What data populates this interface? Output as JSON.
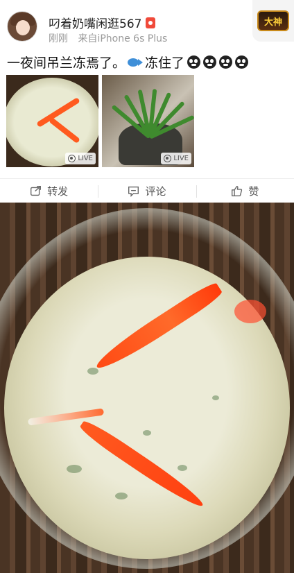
{
  "post": {
    "username": "叼着奶嘴闲逛567",
    "time": "刚刚",
    "source": "来自iPhone 6s Plus",
    "text": "一夜间吊兰冻焉了。",
    "text_after_fish": "冻住了",
    "game_badge": "大神"
  },
  "thumbnails": [
    {
      "name": "goldfish-bowl-photo",
      "live_label": "LIVE"
    },
    {
      "name": "spider-plant-photo",
      "live_label": "LIVE"
    }
  ],
  "actions": {
    "repost": "转发",
    "comment": "评论",
    "like": "赞"
  },
  "icons": [
    "badge-icon",
    "fish-emoji",
    "sob-emoji",
    "live-icon",
    "repost-icon",
    "comment-icon",
    "like-icon"
  ],
  "colors": {
    "fish": "#ff5a1f",
    "muted": "#9a9a9a",
    "badge": "#f04a3a"
  }
}
